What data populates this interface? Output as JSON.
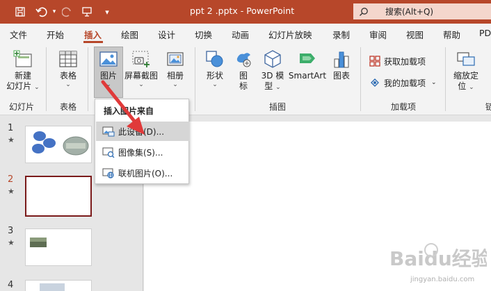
{
  "titlebar": {
    "doc_title": "ppt 2 .pptx - PowerPoint",
    "search_text": "搜索(Alt+Q)"
  },
  "tabs": [
    "文件",
    "开始",
    "插入",
    "绘图",
    "设计",
    "切换",
    "动画",
    "幻灯片放映",
    "录制",
    "审阅",
    "视图",
    "帮助",
    "PD"
  ],
  "active_tab": "插入",
  "ribbon": {
    "new_slide": "新建\n幻灯片",
    "new_slide_l1": "新建",
    "new_slide_l2": "幻灯片",
    "table": "表格",
    "picture": "图片",
    "screenshot": "屏幕截图",
    "album": "相册",
    "shape": "形状",
    "icon": "图",
    "icon_l2": "标",
    "model3d_l1": "3D 模",
    "model3d_l2": "型",
    "smartart": "SmartArt",
    "chart": "图表",
    "get_addins": "获取加载项",
    "my_addins": "我的加载项",
    "zoom_l1": "缩放定",
    "zoom_l2": "位",
    "groups": {
      "slides": "幻灯片",
      "tables": "表格",
      "illustrations": "插图",
      "addins": "加载项",
      "links": "链"
    }
  },
  "dropdown": {
    "header": "插入图片来自",
    "items": [
      "此设备(D)...",
      "图像集(S)...",
      "联机图片(O)..."
    ]
  },
  "slides": [
    {
      "num": "1",
      "star": "★"
    },
    {
      "num": "2",
      "star": "★"
    },
    {
      "num": "3",
      "star": "★"
    },
    {
      "num": "4"
    }
  ],
  "watermark": {
    "brand": "Baidu经验",
    "url": "jingyan.baidu.com"
  },
  "colors": {
    "accent": "#b7472a",
    "search_bg": "#f4d6cc",
    "selected_slide_border": "#7a1a1a",
    "arrow": "#e03a3a"
  }
}
